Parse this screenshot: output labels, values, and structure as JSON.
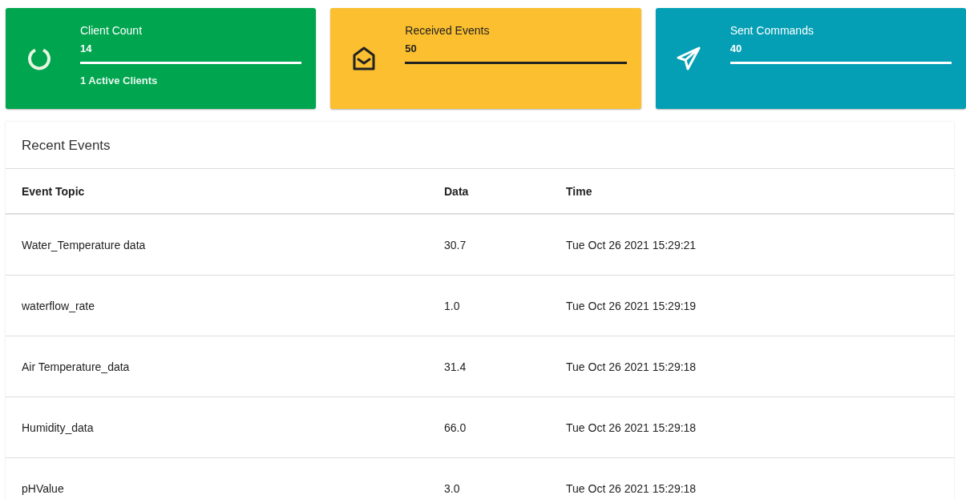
{
  "info_boxes": [
    {
      "title": "Client Count",
      "number": "14",
      "level": 1,
      "description": "1 Active Clients",
      "color": "#00a54f"
    },
    {
      "title": "Received Events",
      "number": "50",
      "level": 1,
      "color": "#fbbf2f"
    },
    {
      "title": "Sent Commands",
      "number": "40",
      "level": 1,
      "color": "#049fb5"
    }
  ],
  "recent_events": {
    "title": "Recent Events",
    "columns": [
      "Event Topic",
      "Data",
      "Time"
    ],
    "rows": [
      [
        "Water_Temperature data",
        "30.7",
        "Tue Oct 26 2021 15:29:21"
      ],
      [
        "waterflow_rate",
        "1.0",
        "Tue Oct 26 2021 15:29:19"
      ],
      [
        "Air Temperature_data",
        "31.4",
        "Tue Oct 26 2021 15:29:18"
      ],
      [
        "Humidity_data",
        "66.0",
        "Tue Oct 26 2021 15:29:18"
      ],
      [
        "pHValue",
        "3.0",
        "Tue Oct 26 2021 15:29:18"
      ]
    ]
  }
}
